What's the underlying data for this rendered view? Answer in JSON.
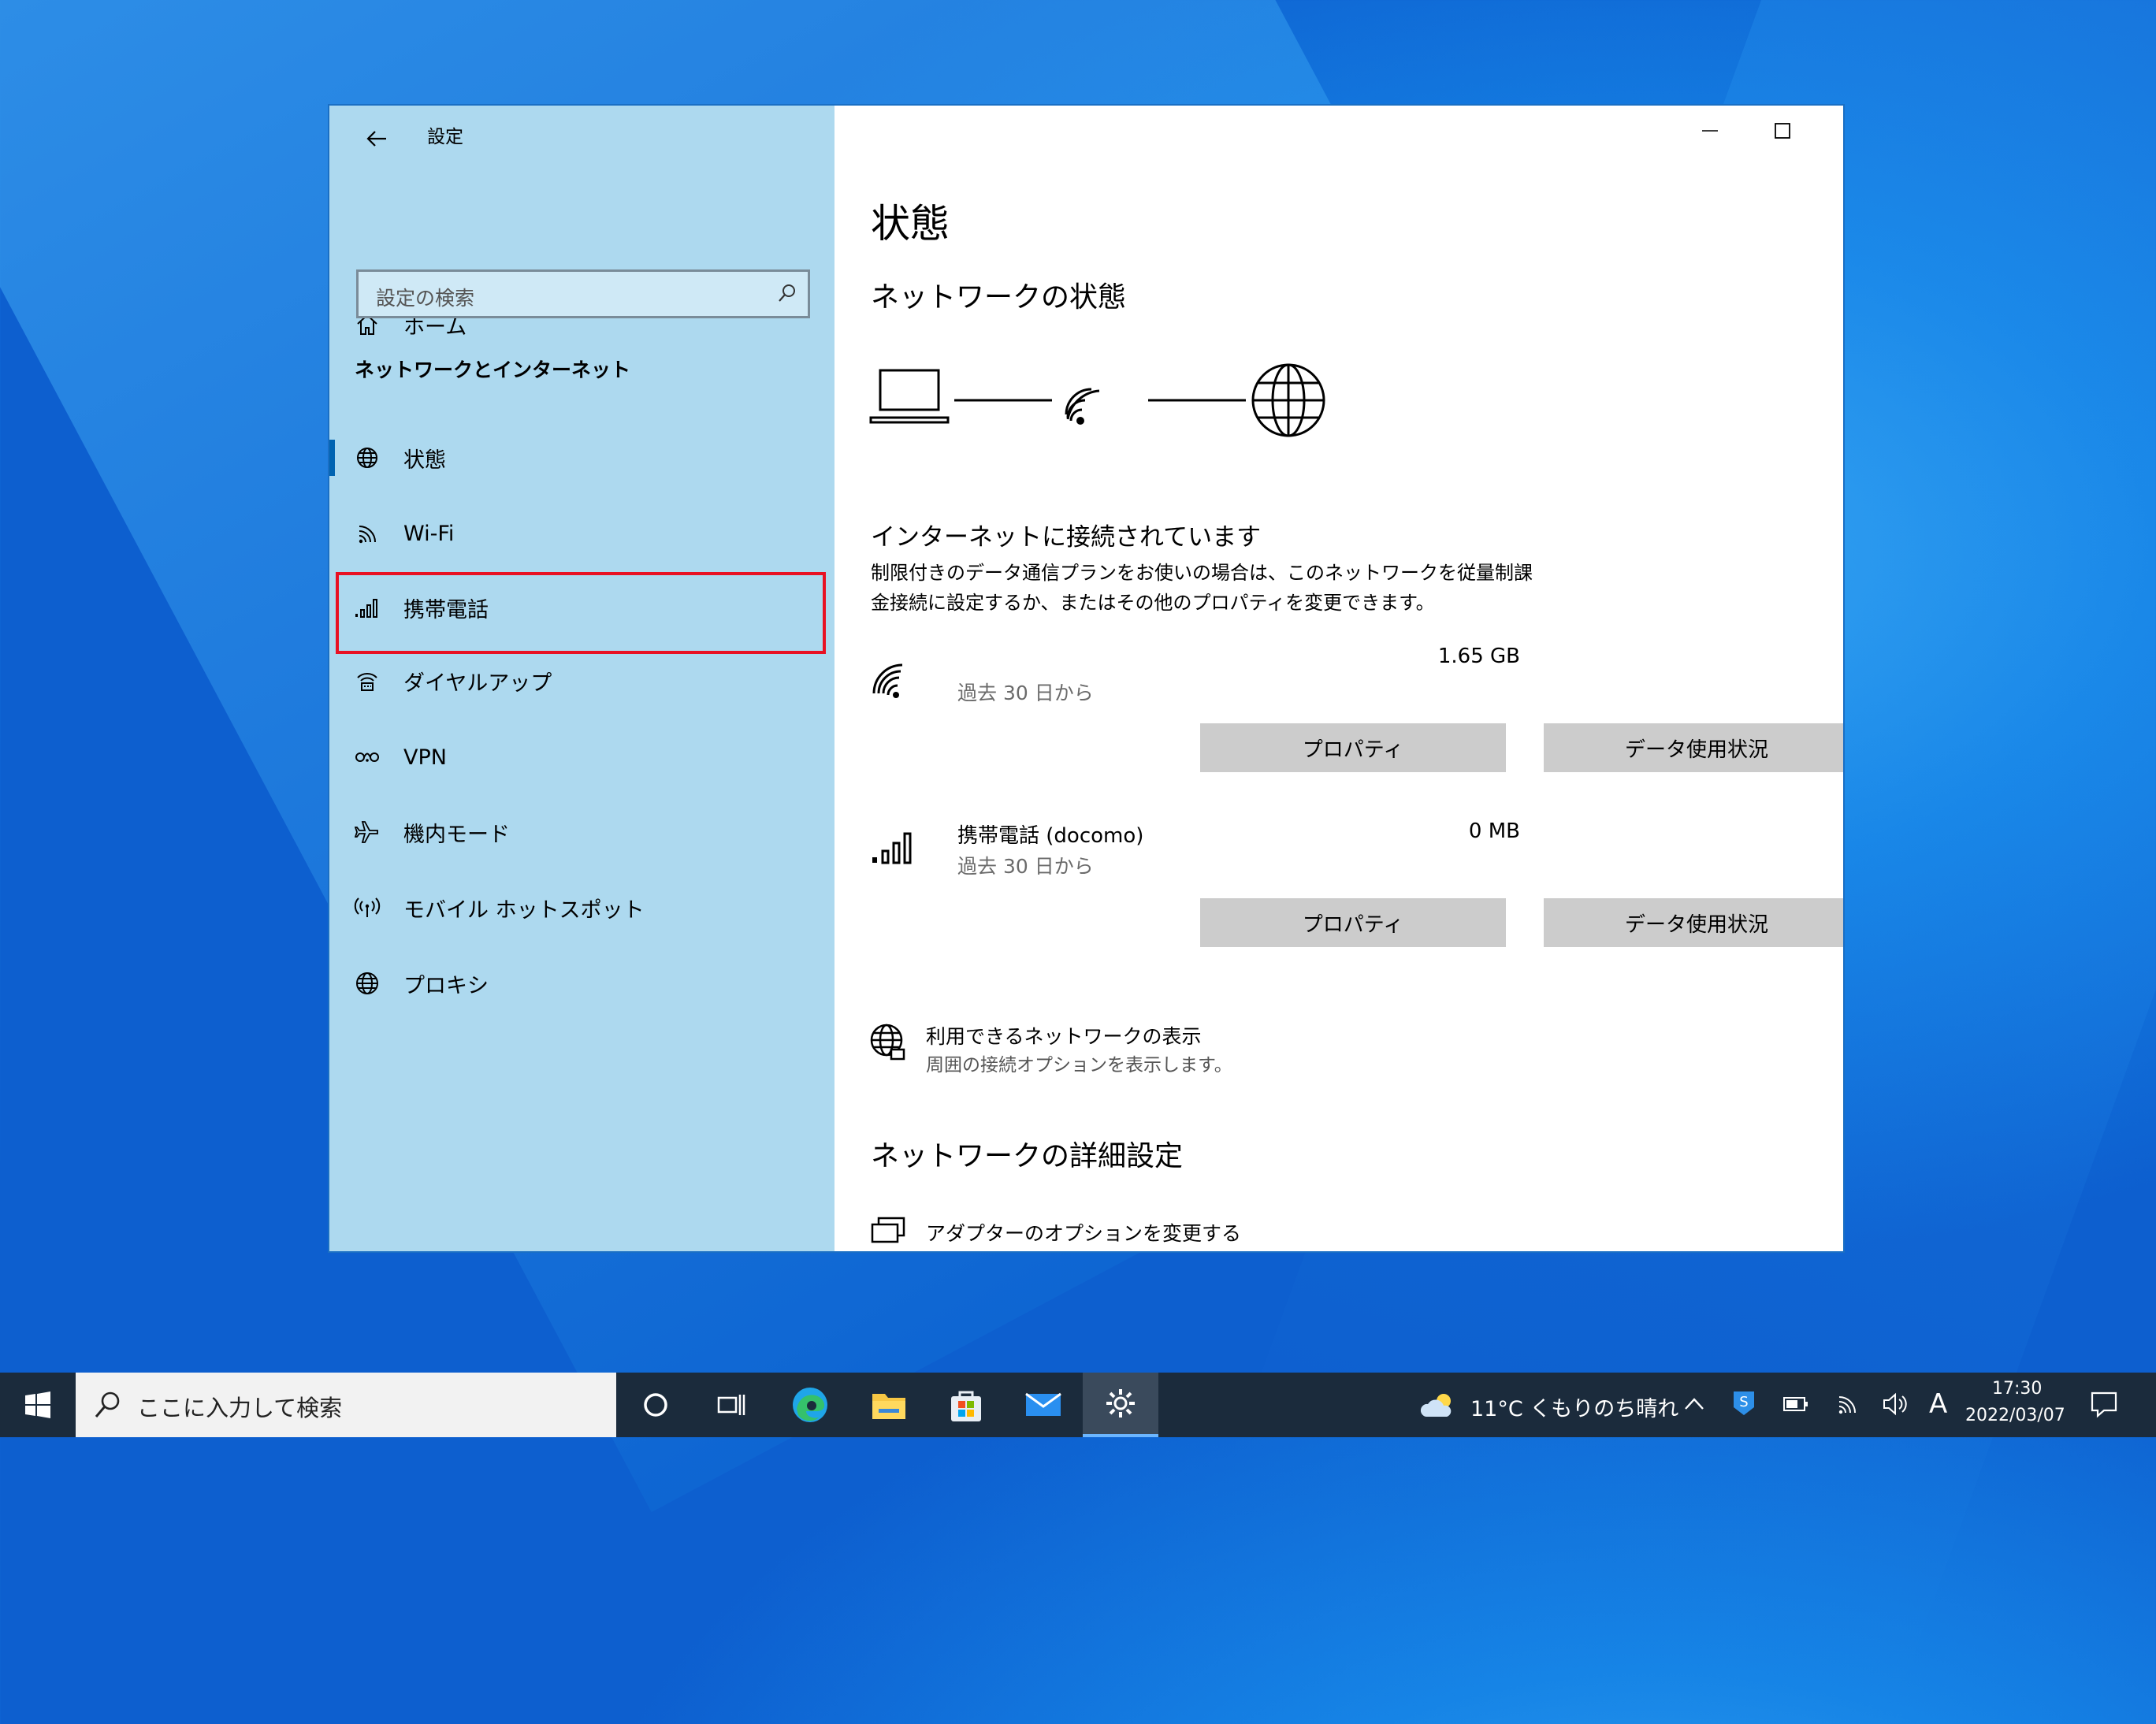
{
  "window": {
    "title": "設定",
    "controls": {
      "minimize": "minimize",
      "maximize": "maximize",
      "close": "close"
    }
  },
  "sidebar": {
    "home_label": "ホーム",
    "search_placeholder": "設定の検索",
    "section_header": "ネットワークとインターネット",
    "items": [
      {
        "label": "状態",
        "icon": "globe-icon",
        "selected": true
      },
      {
        "label": "Wi-Fi",
        "icon": "wifi-icon"
      },
      {
        "label": "携帯電話",
        "icon": "cellular-icon",
        "highlighted": true
      },
      {
        "label": "ダイヤルアップ",
        "icon": "dialup-icon"
      },
      {
        "label": "VPN",
        "icon": "vpn-icon"
      },
      {
        "label": "機内モード",
        "icon": "airplane-icon"
      },
      {
        "label": "モバイル ホットスポット",
        "icon": "hotspot-icon"
      },
      {
        "label": "プロキシ",
        "icon": "proxy-globe-icon"
      }
    ]
  },
  "main": {
    "page_title": "状態",
    "network_status_heading": "ネットワークの状態",
    "connected_heading": "インターネットに接続されています",
    "connected_desc_line1": "制限付きのデータ通信プランをお使いの場合は、このネットワークを従量制課",
    "connected_desc_line2": "金接続に設定するか、またはその他のプロパティを変更できます。",
    "connections": [
      {
        "name": "",
        "usage": "1.65 GB",
        "period": "過去 30 日から",
        "icon": "wifi-icon",
        "properties_label": "プロパティ",
        "data_usage_label": "データ使用状況"
      },
      {
        "name": "携帯電話 (docomo)",
        "usage": "0 MB",
        "period": "過去 30 日から",
        "icon": "cellular-icon",
        "properties_label": "プロパティ",
        "data_usage_label": "データ使用状況"
      }
    ],
    "show_networks": {
      "title": "利用できるネットワークの表示",
      "desc": "周囲の接続オプションを表示します。"
    },
    "advanced_heading": "ネットワークの詳細設定",
    "adapter_options": "アダプターのオプションを変更する"
  },
  "taskbar": {
    "search_placeholder": "ここに入力して検索",
    "weather": "11°C くもりのち晴れ",
    "ime": "A",
    "time": "17:30",
    "date": "2022/03/07"
  },
  "colors": {
    "sidebar_bg": "#add9ef",
    "highlight_border": "#e81123",
    "accent": "#0063b1",
    "button_bg": "#cccccc"
  }
}
